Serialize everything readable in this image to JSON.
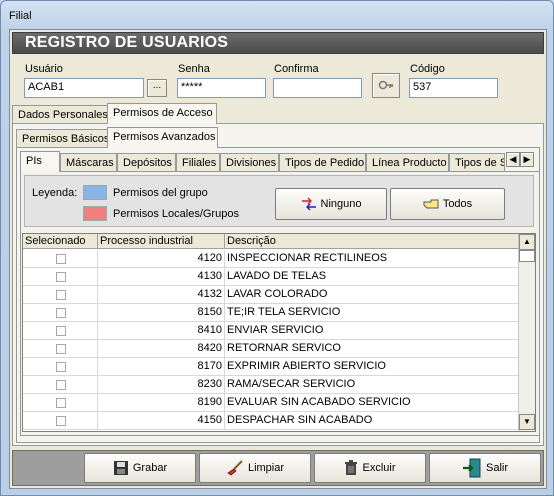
{
  "window": {
    "title": "Filial"
  },
  "header": {
    "title": "REGISTRO DE USUARIOS"
  },
  "form": {
    "usuario_label": "Usuário",
    "usuario_value": "ACAB1",
    "browse_label": "...",
    "senha_label": "Senha",
    "senha_value": "*****",
    "confirma_label": "Confirma",
    "confirma_value": "",
    "codigo_label": "Código",
    "codigo_value": "537"
  },
  "tabs_level1": [
    {
      "label": "Dados Personales",
      "active": false
    },
    {
      "label": "Permisos de Acceso",
      "active": true
    }
  ],
  "tabs_level2": [
    {
      "label": "Permisos Básicos",
      "active": false
    },
    {
      "label": "Permisos Avanzados",
      "active": true
    }
  ],
  "tabs_level3": [
    {
      "label": "PIs",
      "active": true
    },
    {
      "label": "Máscaras",
      "active": false
    },
    {
      "label": "Depósitos",
      "active": false
    },
    {
      "label": "Filiales",
      "active": false
    },
    {
      "label": "Divisiones",
      "active": false
    },
    {
      "label": "Tipos de Pedido",
      "active": false
    },
    {
      "label": "Línea Producto",
      "active": false
    },
    {
      "label": "Tipos de Se",
      "active": false
    }
  ],
  "legend": {
    "label": "Leyenda:",
    "group_label": "Permisos del grupo",
    "group_color": "#8ab4e8",
    "local_label": "Permisos Locales/Grupos",
    "local_color": "#f08080"
  },
  "actions": {
    "none_label": "Ninguno",
    "all_label": "Todos"
  },
  "grid": {
    "columns": [
      "Selecionado",
      "Processo industrial",
      "Descrição"
    ],
    "rows": [
      {
        "code": "4120",
        "desc": "INSPECCIONAR RECTILINEOS"
      },
      {
        "code": "4130",
        "desc": "LAVADO DE TELAS"
      },
      {
        "code": "4132",
        "desc": "LAVAR COLORADO"
      },
      {
        "code": "8150",
        "desc": "TE;IR TELA SERVICIO"
      },
      {
        "code": "8410",
        "desc": "ENVIAR SERVICIO"
      },
      {
        "code": "8420",
        "desc": "RETORNAR SERVICO"
      },
      {
        "code": "8170",
        "desc": "EXPRIMIR ABIERTO SERVICIO"
      },
      {
        "code": "8230",
        "desc": "RAMA/SECAR SERVICIO"
      },
      {
        "code": "8190",
        "desc": "EVALUAR SIN ACABADO SERVICIO"
      },
      {
        "code": "4150",
        "desc": "DESPACHAR SIN ACABADO"
      }
    ]
  },
  "footer": {
    "save_label": "Grabar",
    "clear_label": "Limpiar",
    "delete_label": "Excluir",
    "exit_label": "Salir"
  }
}
